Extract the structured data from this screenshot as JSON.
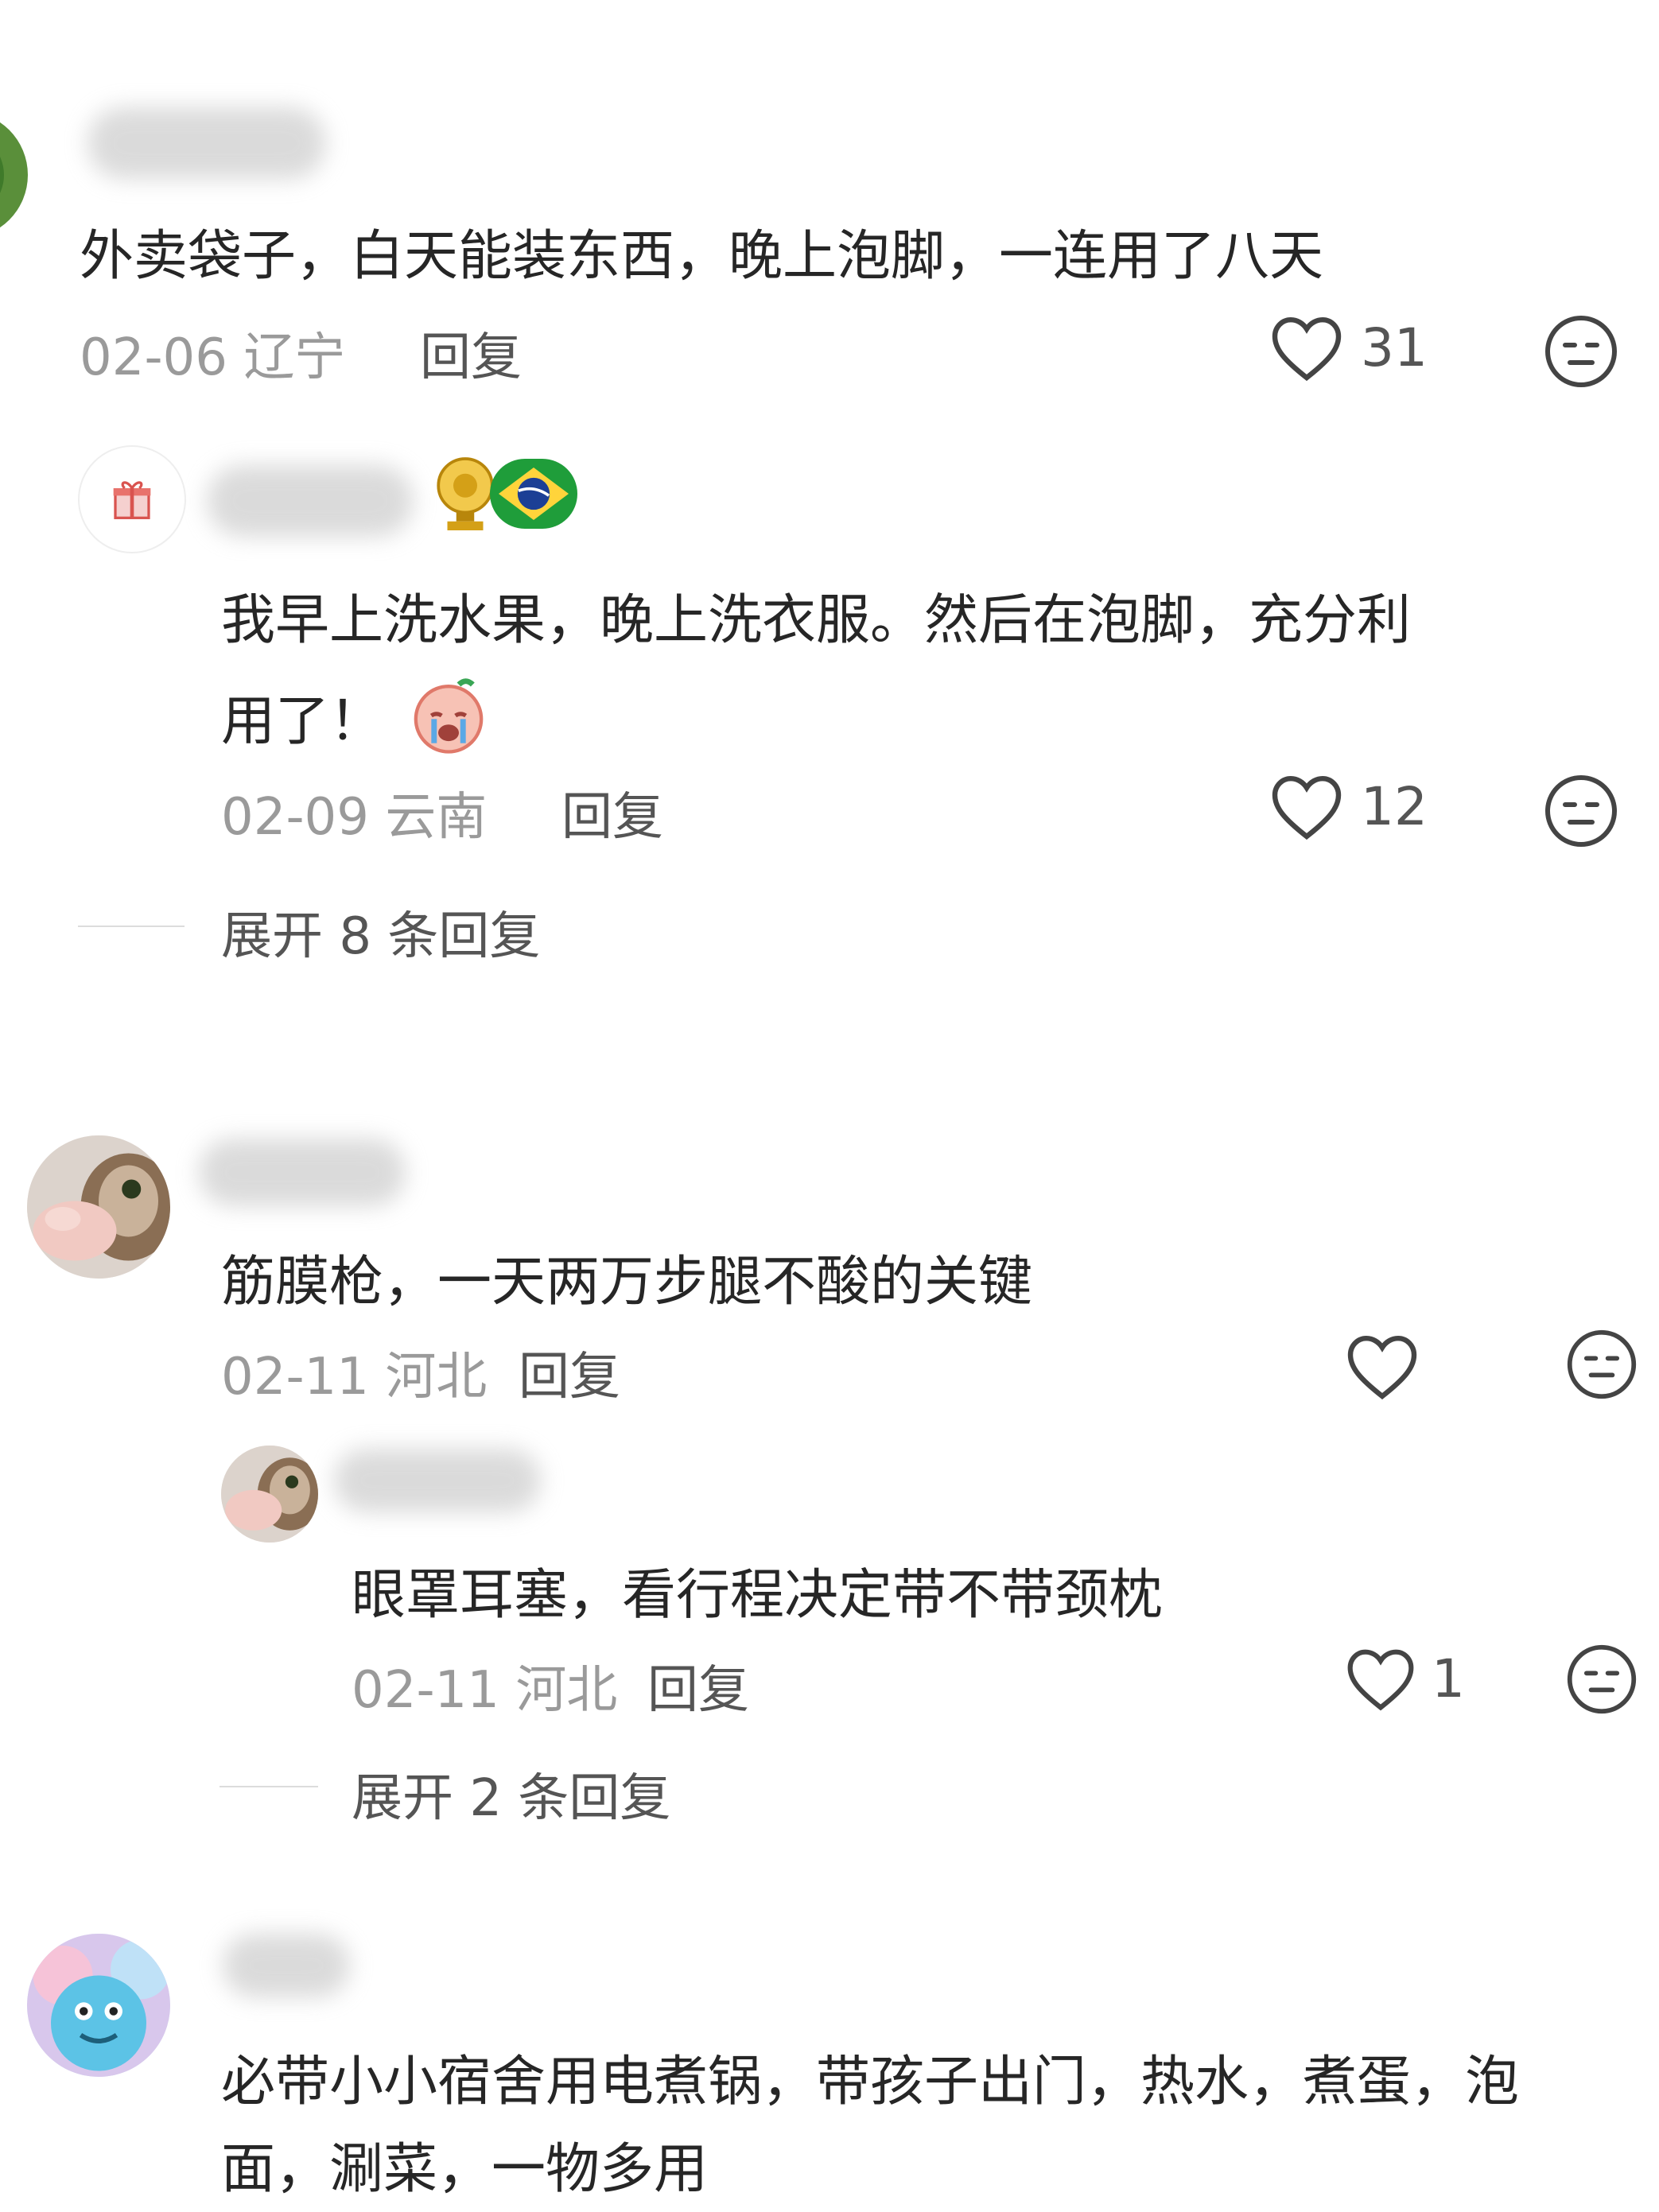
{
  "comments": [
    {
      "text": "外卖袋子，白天能装东西，晚上泡脚，一连用了八天",
      "date": "02-06",
      "location": "辽宁",
      "reply_label": "回复",
      "likes": "31",
      "avatar_icon": "tree-avatar-icon",
      "replies": [
        {
          "text_line1": "我早上洗水果，晚上洗衣服。然后在泡脚，充分利",
          "text_line2": "用了！",
          "emoji": "crying-emoji-icon",
          "badge_icons": [
            "trophy-badge-icon",
            "brazil-flag-icon"
          ],
          "date": "02-09",
          "location": "云南",
          "reply_label": "回复",
          "likes": "12"
        }
      ],
      "expand_label": "展开 8 条回复"
    },
    {
      "text": "筋膜枪，一天两万步腿不酸的关键",
      "date": "02-11",
      "location": "河北",
      "reply_label": "回复",
      "likes": "",
      "avatar_icon": "cat-avatar-icon",
      "replies": [
        {
          "text": "眼罩耳塞，看行程决定带不带颈枕",
          "date": "02-11",
          "location": "河北",
          "reply_label": "回复",
          "likes": "1"
        }
      ],
      "expand_label": "展开 2 条回复"
    },
    {
      "text_line1": "必带小小宿舍用电煮锅，带孩子出门，热水，煮蛋，泡",
      "text_line2": "面，涮菜，一物多用",
      "avatar_icon": "monster-avatar-icon"
    }
  ],
  "colors": {
    "text": "#262626",
    "meta": "#9a9a9a",
    "action": "#555555",
    "divider": "#dcdcdc"
  }
}
